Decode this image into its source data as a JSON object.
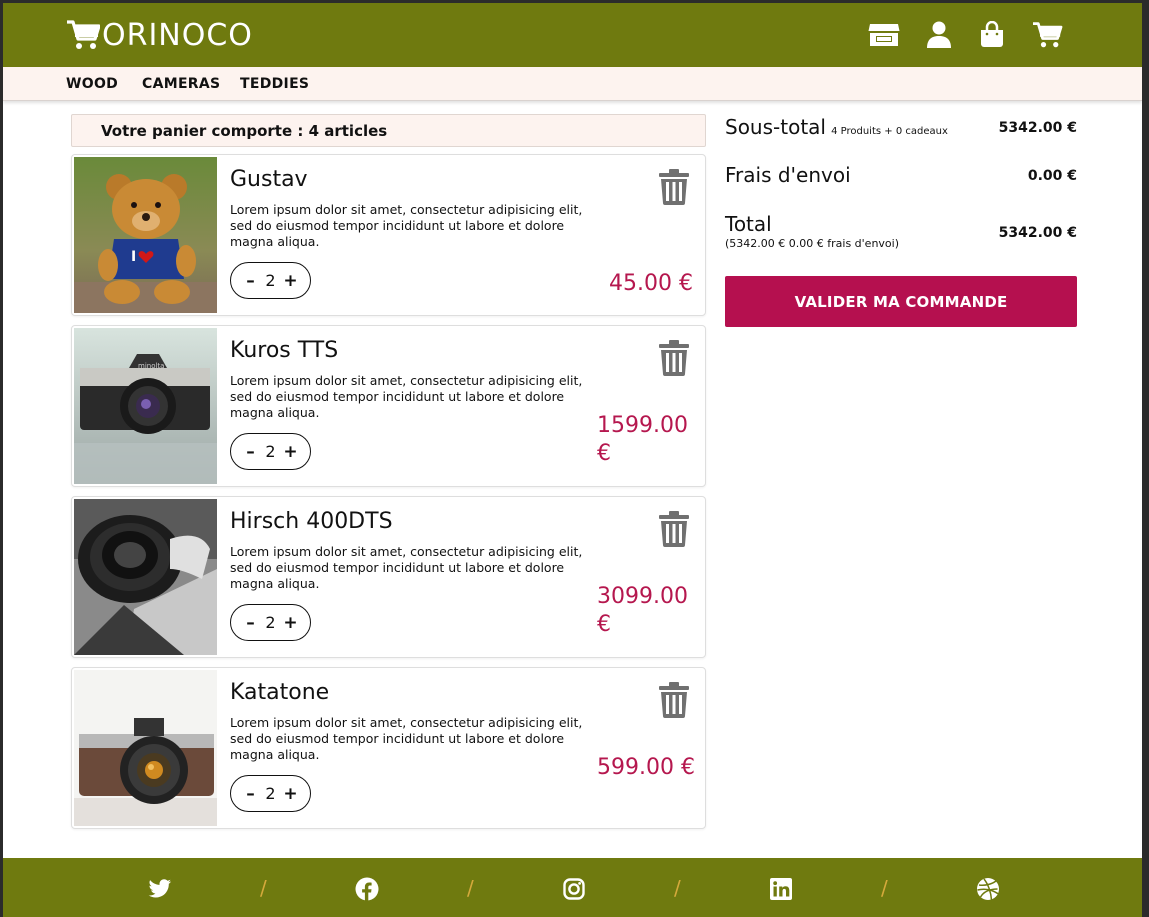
{
  "header": {
    "logo_text": "ORINOCO",
    "icons": [
      "shop-icon",
      "user-icon",
      "bag-icon",
      "cart-icon"
    ]
  },
  "nav": {
    "items": [
      "WOOD",
      "CAMERAS",
      "TEDDIES"
    ]
  },
  "cart": {
    "count_label": "Votre panier comporte : 4 articles",
    "items": [
      {
        "name": "Gustav",
        "description": "Lorem ipsum dolor sit amet, consectetur adipisicing elit, sed do eiusmod tempor incididunt ut labore et dolore magna aliqua.",
        "quantity": "2",
        "minus": "–",
        "plus": "+",
        "price": "45.00 €",
        "image": "teddy-bear-photo"
      },
      {
        "name": "Kuros TTS",
        "description": "Lorem ipsum dolor sit amet, consectetur adipisicing elit, sed do eiusmod tempor incididunt ut labore et dolore magna aliqua.",
        "quantity": "2",
        "minus": "–",
        "plus": "+",
        "price": "1599.00 €",
        "image": "vintage-camera-photo"
      },
      {
        "name": "Hirsch 400DTS",
        "description": "Lorem ipsum dolor sit amet, consectetur adipisicing elit, sed do eiusmod tempor incididunt ut labore et dolore magna aliqua.",
        "quantity": "2",
        "minus": "–",
        "plus": "+",
        "price": "3099.00 €",
        "image": "bw-camera-lens-photo"
      },
      {
        "name": "Katatone",
        "description": "Lorem ipsum dolor sit amet, consectetur adipisicing elit, sed do eiusmod tempor incididunt ut labore et dolore magna aliqua.",
        "quantity": "2",
        "minus": "–",
        "plus": "+",
        "price": "599.00 €",
        "image": "brown-camera-photo"
      }
    ]
  },
  "summary": {
    "subtotal_label": "Sous-total",
    "subtotal_note": "4 Produits + 0 cadeaux",
    "subtotal_value": "5342.00 €",
    "shipping_label": "Frais d'envoi",
    "shipping_value": "0.00 €",
    "total_label": "Total",
    "total_note": "(5342.00 € 0.00 € frais d'envoi)",
    "total_value": "5342.00 €",
    "validate_label": "VALIDER MA COMMANDE"
  },
  "footer": {
    "icons": [
      "twitter-icon",
      "facebook-icon",
      "instagram-icon",
      "linkedin-icon",
      "dribbble-icon"
    ],
    "separator": "/"
  },
  "colors": {
    "brand_olive": "#6f7a0f",
    "accent_crimson": "#b5104f",
    "nav_bg": "#fdf3ef",
    "separator_gold": "#d4a93b",
    "trash_gray": "#707070"
  }
}
